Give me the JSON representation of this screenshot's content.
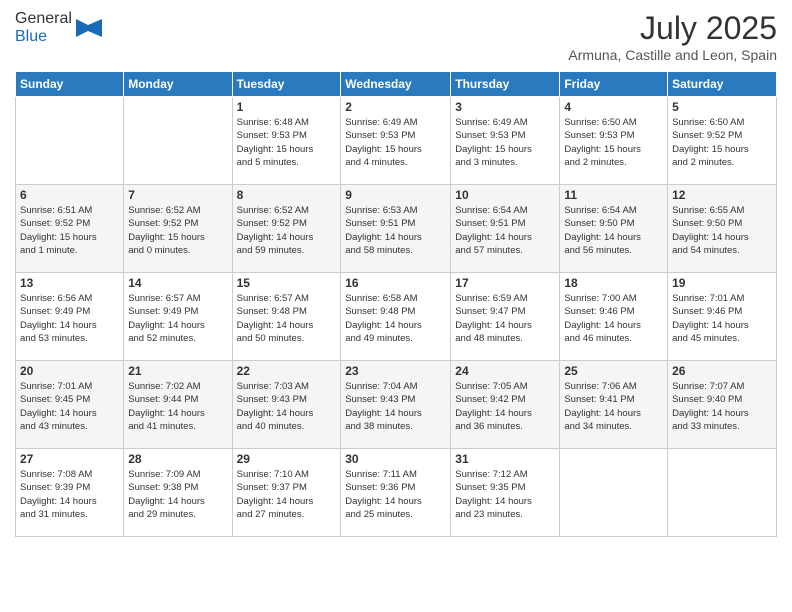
{
  "header": {
    "logo_general": "General",
    "logo_blue": "Blue",
    "title": "July 2025",
    "subtitle": "Armuna, Castille and Leon, Spain"
  },
  "calendar": {
    "days_of_week": [
      "Sunday",
      "Monday",
      "Tuesday",
      "Wednesday",
      "Thursday",
      "Friday",
      "Saturday"
    ],
    "weeks": [
      [
        {
          "num": "",
          "info": ""
        },
        {
          "num": "",
          "info": ""
        },
        {
          "num": "1",
          "info": "Sunrise: 6:48 AM\nSunset: 9:53 PM\nDaylight: 15 hours\nand 5 minutes."
        },
        {
          "num": "2",
          "info": "Sunrise: 6:49 AM\nSunset: 9:53 PM\nDaylight: 15 hours\nand 4 minutes."
        },
        {
          "num": "3",
          "info": "Sunrise: 6:49 AM\nSunset: 9:53 PM\nDaylight: 15 hours\nand 3 minutes."
        },
        {
          "num": "4",
          "info": "Sunrise: 6:50 AM\nSunset: 9:53 PM\nDaylight: 15 hours\nand 2 minutes."
        },
        {
          "num": "5",
          "info": "Sunrise: 6:50 AM\nSunset: 9:52 PM\nDaylight: 15 hours\nand 2 minutes."
        }
      ],
      [
        {
          "num": "6",
          "info": "Sunrise: 6:51 AM\nSunset: 9:52 PM\nDaylight: 15 hours\nand 1 minute."
        },
        {
          "num": "7",
          "info": "Sunrise: 6:52 AM\nSunset: 9:52 PM\nDaylight: 15 hours\nand 0 minutes."
        },
        {
          "num": "8",
          "info": "Sunrise: 6:52 AM\nSunset: 9:52 PM\nDaylight: 14 hours\nand 59 minutes."
        },
        {
          "num": "9",
          "info": "Sunrise: 6:53 AM\nSunset: 9:51 PM\nDaylight: 14 hours\nand 58 minutes."
        },
        {
          "num": "10",
          "info": "Sunrise: 6:54 AM\nSunset: 9:51 PM\nDaylight: 14 hours\nand 57 minutes."
        },
        {
          "num": "11",
          "info": "Sunrise: 6:54 AM\nSunset: 9:50 PM\nDaylight: 14 hours\nand 56 minutes."
        },
        {
          "num": "12",
          "info": "Sunrise: 6:55 AM\nSunset: 9:50 PM\nDaylight: 14 hours\nand 54 minutes."
        }
      ],
      [
        {
          "num": "13",
          "info": "Sunrise: 6:56 AM\nSunset: 9:49 PM\nDaylight: 14 hours\nand 53 minutes."
        },
        {
          "num": "14",
          "info": "Sunrise: 6:57 AM\nSunset: 9:49 PM\nDaylight: 14 hours\nand 52 minutes."
        },
        {
          "num": "15",
          "info": "Sunrise: 6:57 AM\nSunset: 9:48 PM\nDaylight: 14 hours\nand 50 minutes."
        },
        {
          "num": "16",
          "info": "Sunrise: 6:58 AM\nSunset: 9:48 PM\nDaylight: 14 hours\nand 49 minutes."
        },
        {
          "num": "17",
          "info": "Sunrise: 6:59 AM\nSunset: 9:47 PM\nDaylight: 14 hours\nand 48 minutes."
        },
        {
          "num": "18",
          "info": "Sunrise: 7:00 AM\nSunset: 9:46 PM\nDaylight: 14 hours\nand 46 minutes."
        },
        {
          "num": "19",
          "info": "Sunrise: 7:01 AM\nSunset: 9:46 PM\nDaylight: 14 hours\nand 45 minutes."
        }
      ],
      [
        {
          "num": "20",
          "info": "Sunrise: 7:01 AM\nSunset: 9:45 PM\nDaylight: 14 hours\nand 43 minutes."
        },
        {
          "num": "21",
          "info": "Sunrise: 7:02 AM\nSunset: 9:44 PM\nDaylight: 14 hours\nand 41 minutes."
        },
        {
          "num": "22",
          "info": "Sunrise: 7:03 AM\nSunset: 9:43 PM\nDaylight: 14 hours\nand 40 minutes."
        },
        {
          "num": "23",
          "info": "Sunrise: 7:04 AM\nSunset: 9:43 PM\nDaylight: 14 hours\nand 38 minutes."
        },
        {
          "num": "24",
          "info": "Sunrise: 7:05 AM\nSunset: 9:42 PM\nDaylight: 14 hours\nand 36 minutes."
        },
        {
          "num": "25",
          "info": "Sunrise: 7:06 AM\nSunset: 9:41 PM\nDaylight: 14 hours\nand 34 minutes."
        },
        {
          "num": "26",
          "info": "Sunrise: 7:07 AM\nSunset: 9:40 PM\nDaylight: 14 hours\nand 33 minutes."
        }
      ],
      [
        {
          "num": "27",
          "info": "Sunrise: 7:08 AM\nSunset: 9:39 PM\nDaylight: 14 hours\nand 31 minutes."
        },
        {
          "num": "28",
          "info": "Sunrise: 7:09 AM\nSunset: 9:38 PM\nDaylight: 14 hours\nand 29 minutes."
        },
        {
          "num": "29",
          "info": "Sunrise: 7:10 AM\nSunset: 9:37 PM\nDaylight: 14 hours\nand 27 minutes."
        },
        {
          "num": "30",
          "info": "Sunrise: 7:11 AM\nSunset: 9:36 PM\nDaylight: 14 hours\nand 25 minutes."
        },
        {
          "num": "31",
          "info": "Sunrise: 7:12 AM\nSunset: 9:35 PM\nDaylight: 14 hours\nand 23 minutes."
        },
        {
          "num": "",
          "info": ""
        },
        {
          "num": "",
          "info": ""
        }
      ]
    ]
  }
}
